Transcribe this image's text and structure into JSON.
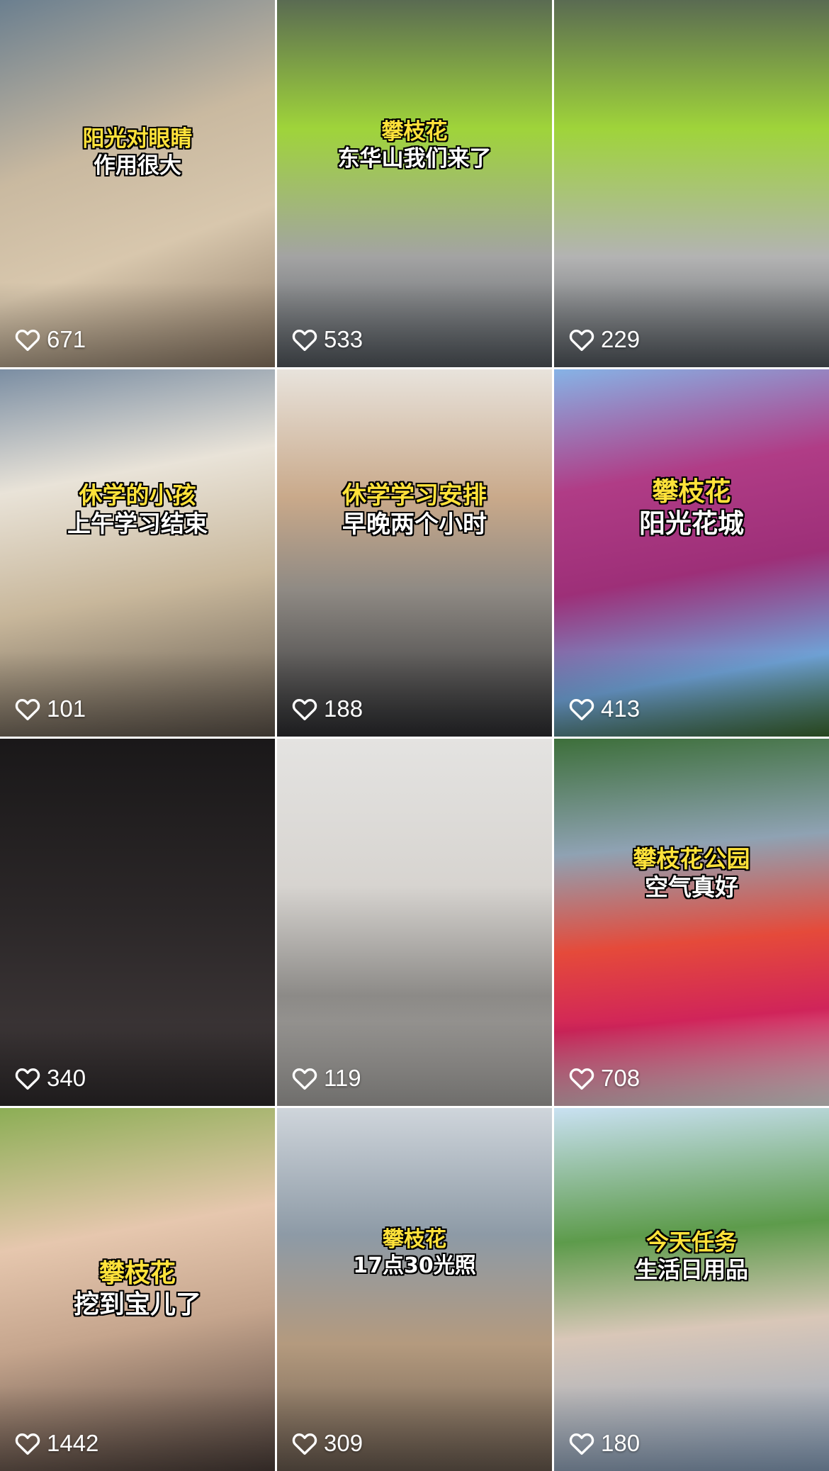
{
  "grid": {
    "items": [
      {
        "caption": [
          "阳光对眼睛",
          "作用很大"
        ],
        "caption_colors": [
          "yellow",
          "white"
        ],
        "likes": "671"
      },
      {
        "caption": [
          "攀枝花",
          "东华山我们来了"
        ],
        "caption_colors": [
          "yellow",
          "white"
        ],
        "likes": "533"
      },
      {
        "caption": [],
        "caption_colors": [],
        "likes": "229"
      },
      {
        "caption": [
          "休学的小孩",
          "上午学习结束"
        ],
        "caption_colors": [
          "yellow",
          "white"
        ],
        "likes": "101"
      },
      {
        "caption": [
          "休学学习安排",
          "早晚两个小时"
        ],
        "caption_colors": [
          "yellow",
          "white"
        ],
        "likes": "188"
      },
      {
        "caption": [
          "攀枝花",
          "阳光花城"
        ],
        "caption_colors": [
          "yellow",
          "white"
        ],
        "likes": "413"
      },
      {
        "caption": [],
        "caption_colors": [],
        "likes": "340"
      },
      {
        "caption": [],
        "caption_colors": [],
        "likes": "119"
      },
      {
        "caption": [
          "攀枝花公园",
          "空气真好"
        ],
        "caption_colors": [
          "yellow",
          "white"
        ],
        "likes": "708"
      },
      {
        "caption": [
          "攀枝花",
          "挖到宝儿了"
        ],
        "caption_colors": [
          "yellow",
          "white"
        ],
        "likes": "1442"
      },
      {
        "caption": [
          "攀枝花",
          "17点30光照"
        ],
        "caption_colors": [
          "yellow",
          "white"
        ],
        "likes": "309"
      },
      {
        "caption": [
          "今天任务",
          "生活日用品"
        ],
        "caption_colors": [
          "yellow",
          "white"
        ],
        "likes": "180"
      }
    ]
  },
  "icons": {
    "like": "heart-outline-icon"
  },
  "colors": {
    "caption_primary": "#ffe23a",
    "caption_secondary": "#ffffff",
    "caption_stroke": "#000000"
  }
}
